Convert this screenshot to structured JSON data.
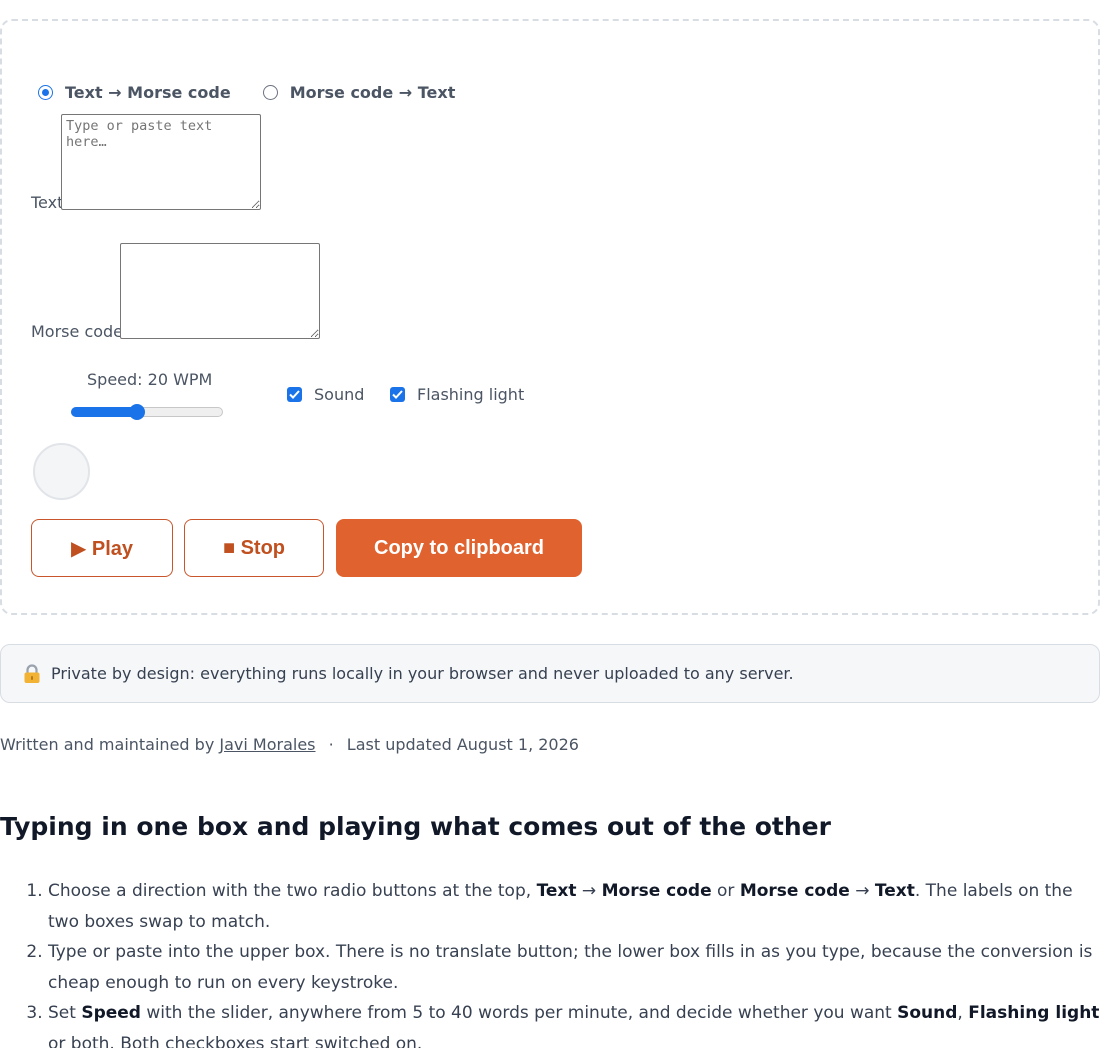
{
  "tool": {
    "direction_options": [
      "Text → Morse code",
      "Morse code → Text"
    ],
    "selected_direction": "Text → Morse code",
    "text_label": "Text",
    "text_value": "",
    "text_placeholder": "Type or paste text here…",
    "morse_label": "Morse code",
    "morse_value": "",
    "speed_label": "Speed: 20 WPM",
    "speed": {
      "min": 5,
      "max": 40,
      "value": 20
    },
    "sound_label": "Sound",
    "sound_checked": true,
    "light_label": "Flashing light",
    "light_checked": true,
    "play_label": "▶ Play",
    "stop_label": "■ Stop",
    "copy_label": "Copy to clipboard"
  },
  "privacy": {
    "icon": "lock-icon",
    "text": "Private by design: everything runs locally in your browser and never uploaded to any server."
  },
  "byline": {
    "prefix": "Written and maintained by",
    "author": "Javi Morales",
    "separator": "·",
    "updated": "Last updated August 1, 2026"
  },
  "article": {
    "heading": "Typing in one box and playing what comes out of the other",
    "steps": [
      [
        "Choose a direction with the two radio buttons at the top, ",
        {
          "b": "Text"
        },
        " → ",
        {
          "b": "Morse code"
        },
        " or ",
        {
          "b": "Morse code"
        },
        " → ",
        {
          "b": "Text"
        },
        ". The labels on the two boxes swap to match."
      ],
      [
        "Type or paste into the upper box. There is no translate button; the lower box fills in as you type, because the conversion is cheap enough to run on every keystroke."
      ],
      [
        "Set ",
        {
          "b": "Speed"
        },
        " with the slider, anywhere from 5 to 40 words per minute, and decide whether you want ",
        {
          "b": "Sound"
        },
        ", ",
        {
          "b": "Flashing light"
        },
        " or both. Both checkboxes start switched on."
      ]
    ]
  },
  "colors": {
    "accent_blue": "#1a73e8",
    "brand_orange": "#e0622e",
    "brand_orange_text": "#c0501f"
  }
}
